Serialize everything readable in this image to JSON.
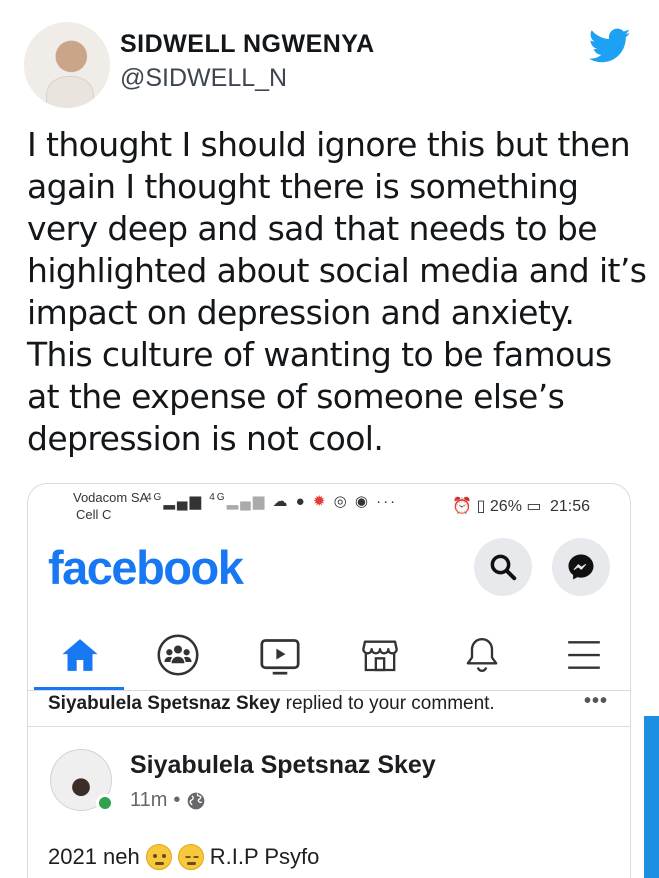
{
  "tweet": {
    "author_name": "SIDWELL NGWENYA",
    "author_handle": "@SIDWELL_N",
    "icon": "twitter-bird-icon",
    "text": "I thought I should ignore this but then again I thought there is something very deep and sad that needs to be highlighted about social media and it’s impact on depression and anxiety. This culture of wanting to be famous at the expense of someone else’s depression is not cool."
  },
  "screenshot": {
    "status_bar": {
      "carrier_1": "Vodacom SA",
      "carrier_2": "Cell C",
      "network_1": "4G",
      "network_2": "4G",
      "battery": "26%",
      "time": "21:56"
    },
    "header": {
      "logo": "facebook",
      "search_icon": "search-icon",
      "messenger_icon": "messenger-icon"
    },
    "nav": [
      {
        "name": "home",
        "icon": "home-icon",
        "active": true
      },
      {
        "name": "groups",
        "icon": "groups-icon"
      },
      {
        "name": "watch",
        "icon": "video-icon"
      },
      {
        "name": "marketplace",
        "icon": "store-icon"
      },
      {
        "name": "notifications",
        "icon": "bell-icon"
      },
      {
        "name": "menu",
        "icon": "menu-icon"
      }
    ],
    "notification": {
      "name": "Siyabulela Spetsnaz Skey",
      "action": " replied to your comment."
    },
    "post": {
      "author": "Siyabulela Spetsnaz Skey",
      "time": "11m",
      "separator": "•",
      "text_before": "2021 neh",
      "text_after": "R.I.P Psyfo"
    },
    "colors": {
      "facebook_blue": "#1877f2",
      "twitter_blue": "#1da1f2",
      "online_green": "#31a24c"
    }
  }
}
